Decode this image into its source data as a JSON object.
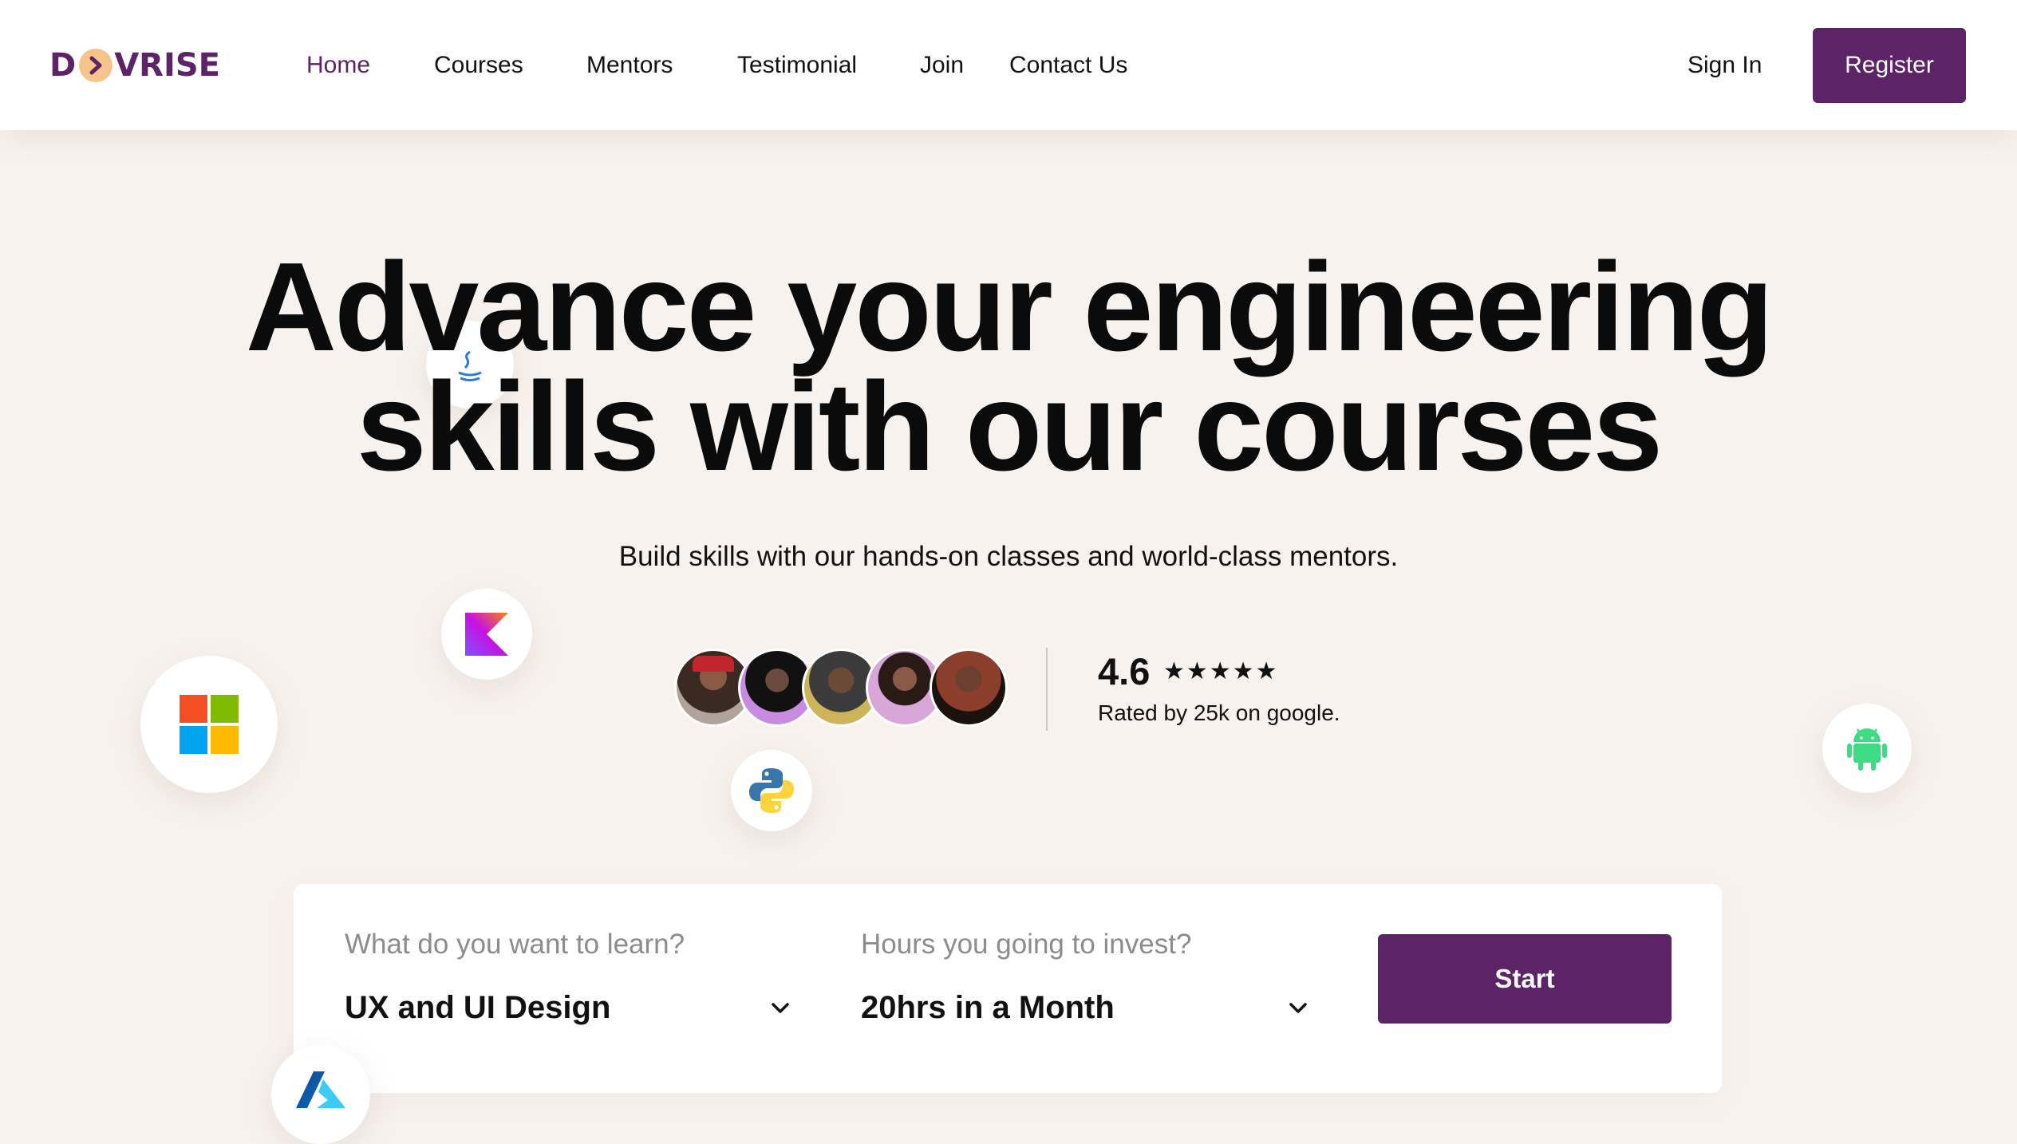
{
  "brand": {
    "logo_left": "D",
    "logo_right": "VRISE",
    "accent_color": "#5d2367",
    "badge_color": "#f5c48a"
  },
  "nav": {
    "items": [
      {
        "label": "Home",
        "active": true
      },
      {
        "label": "Courses",
        "active": false
      },
      {
        "label": "Mentors",
        "active": false
      },
      {
        "label": "Testimonial",
        "active": false
      },
      {
        "label": "Join",
        "active": false
      },
      {
        "label": "Contact Us",
        "active": false
      }
    ],
    "sign_in": "Sign In",
    "register": "Register"
  },
  "hero": {
    "title_line1": "Advance your engineering",
    "title_line2": "skills with our courses",
    "subtitle": "Build skills with our hands-on classes and world-class mentors."
  },
  "social_proof": {
    "rating": "4.6",
    "stars": "★★★★★",
    "star_value": 4.6,
    "rated_text": "Rated by 25k on google.",
    "avatars": [
      "mentor-avatar",
      "mentor-avatar",
      "mentor-avatar",
      "mentor-avatar",
      "mentor-avatar"
    ]
  },
  "floating_icons": [
    "java-icon",
    "kotlin-icon",
    "windows-icon",
    "python-icon",
    "android-icon",
    "azure-icon"
  ],
  "search": {
    "learn_label": "What do you want to learn?",
    "learn_value": "UX and UI Design",
    "hours_label": "Hours you going to invest?",
    "hours_value": "20hrs in a Month",
    "start_label": "Start"
  }
}
